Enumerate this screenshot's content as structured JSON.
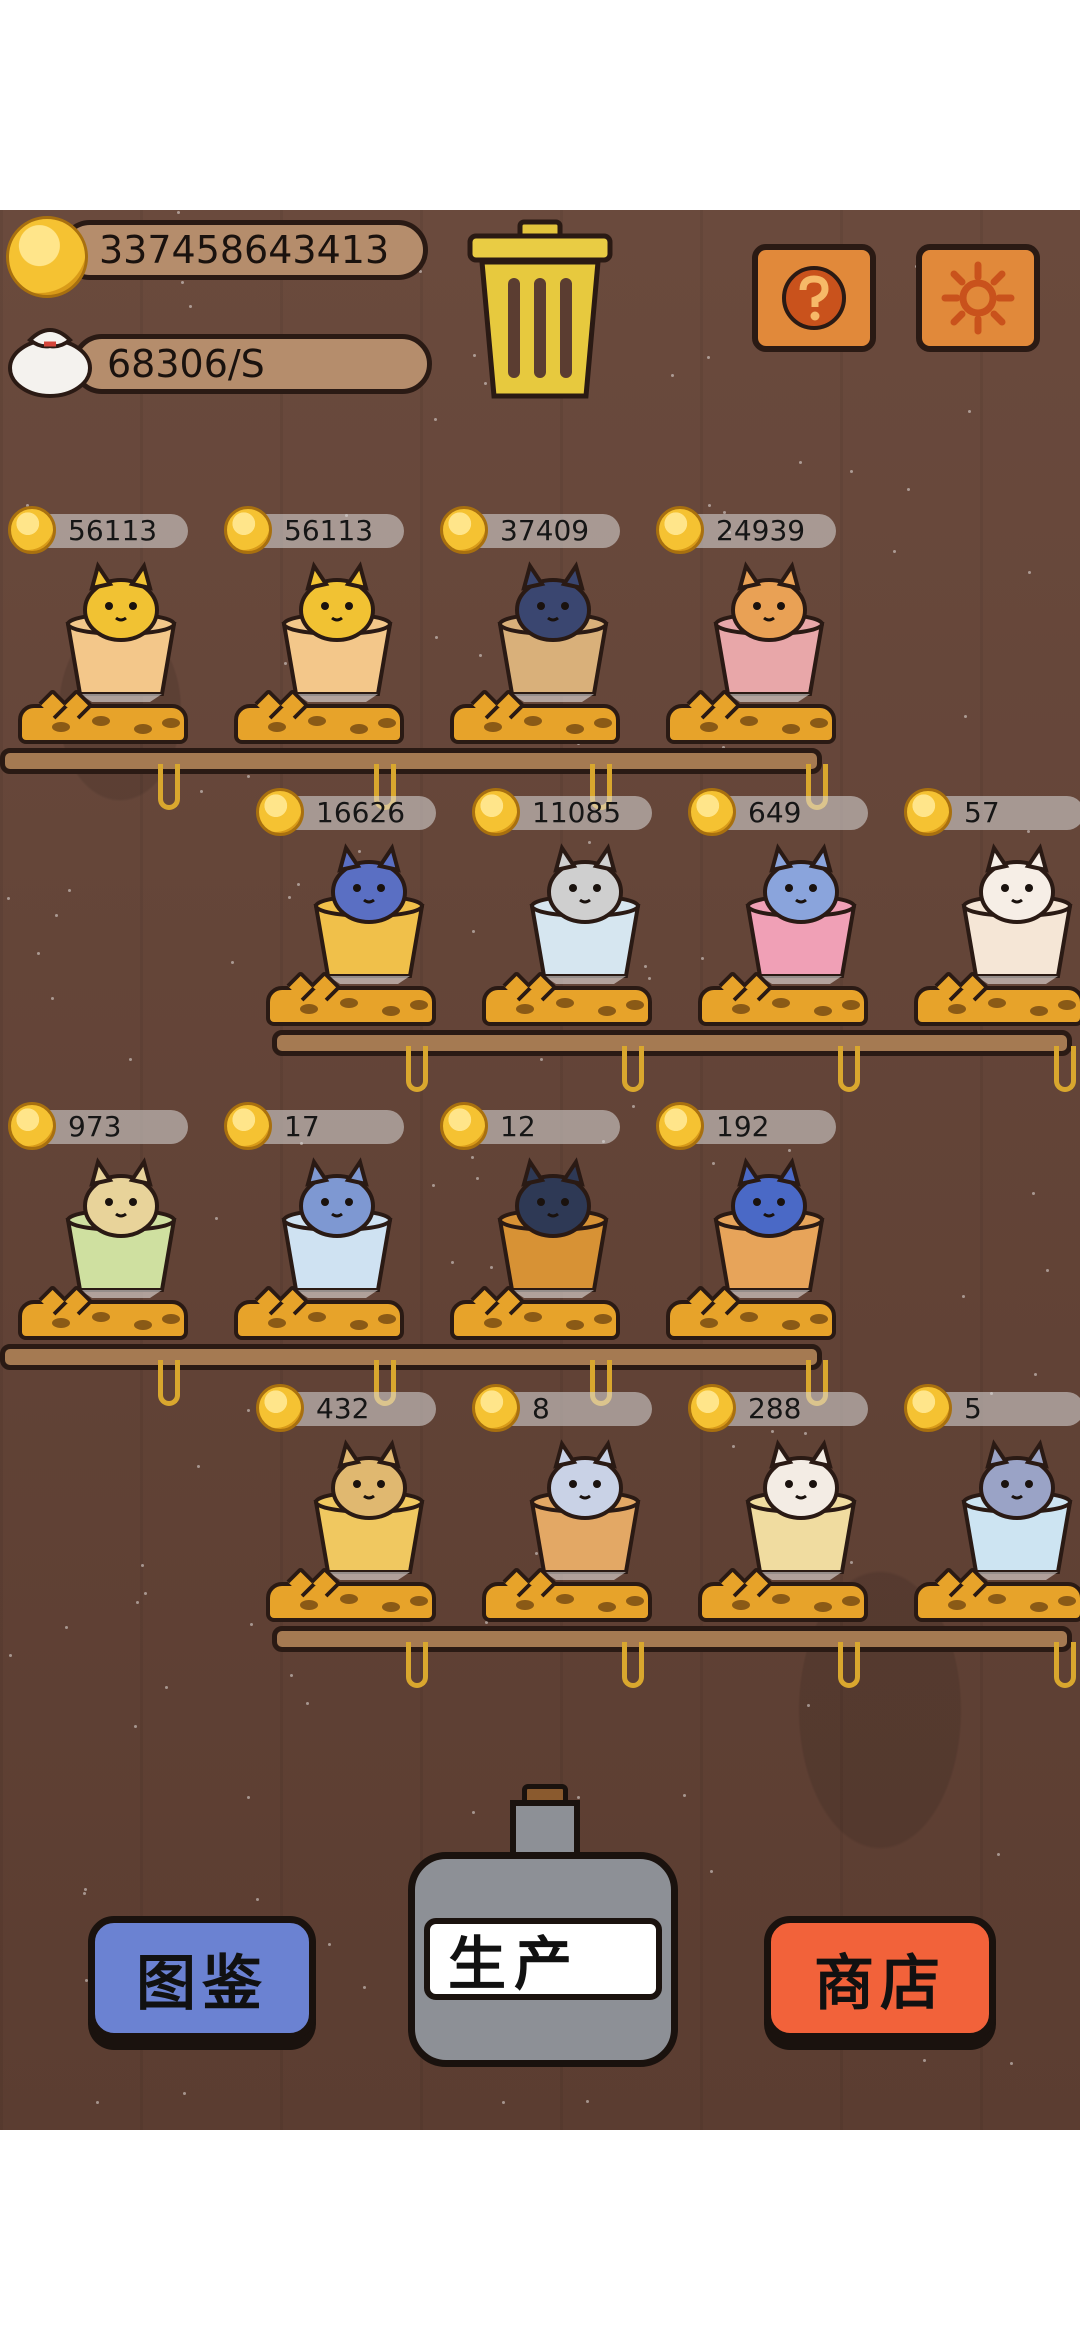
{
  "hud": {
    "coins": "337458643413",
    "rate": "68306/S",
    "trash_icon": "trash-can-icon",
    "help_icon": "question-mark-icon",
    "settings_icon": "gear-sun-icon"
  },
  "rows": [
    {
      "slots": [
        {
          "value": "56113",
          "cat": "yellow-cat-red-vest",
          "cup": "#f3c78a",
          "body": "#f1c233"
        },
        {
          "value": "56113",
          "cat": "yellow-cat-red-vest",
          "cup": "#f3c78a",
          "body": "#f1c233"
        },
        {
          "value": "37409",
          "cat": "navy-cat-in-cup",
          "cup": "#d9b07a",
          "body": "#3a4670"
        },
        {
          "value": "24939",
          "cat": "orange-cat-in-glass",
          "cup": "#e8a7a9",
          "body": "#e9a155"
        }
      ]
    },
    {
      "slots": [
        {
          "value": "16626",
          "cat": "purple-witch-cat-mug",
          "cup": "#f0c04a",
          "body": "#5a6fc3"
        },
        {
          "value": "11085",
          "cat": "siamese-cat-glass",
          "cup": "#d6e6f0",
          "body": "#cfcfcf"
        },
        {
          "value": "649",
          "cat": "blue-cat-parfait",
          "cup": "#f0a0b6",
          "body": "#8aa4dc"
        },
        {
          "value": "57",
          "cat": "white-cat-bowl",
          "cup": "#f5e6d6",
          "body": "#f6eee6"
        }
      ]
    },
    {
      "slots": [
        {
          "value": "973",
          "cat": "sunflower-cat-glass",
          "cup": "#cfe0a0",
          "body": "#e8d39a"
        },
        {
          "value": "17",
          "cat": "blue-cat-ice-glass",
          "cup": "#cfe2f2",
          "body": "#7e98d2"
        },
        {
          "value": "12",
          "cat": "pirate-cat-bowl",
          "cup": "#d79235",
          "body": "#2e3955"
        },
        {
          "value": "192",
          "cat": "blue-cat-red-hood-mug",
          "cup": "#e7a45a",
          "body": "#4a69c6"
        }
      ]
    },
    {
      "slots": [
        {
          "value": "432",
          "cat": "cat-in-tall-glass",
          "cup": "#f0c860",
          "body": "#e0b870"
        },
        {
          "value": "8",
          "cat": "sunglasses-cat-bowl",
          "cup": "#e3a865",
          "body": "#c9d2e6"
        },
        {
          "value": "288",
          "cat": "cat-red-jacket-cake",
          "cup": "#f0dca0",
          "body": "#f3ece4"
        },
        {
          "value": "5",
          "cat": "grey-cat-scarf-glass",
          "cup": "#cde4f2",
          "body": "#9aa3c6"
        }
      ]
    }
  ],
  "buttons": {
    "collection": "图鉴",
    "produce": "生产",
    "shop": "商店"
  },
  "colors": {
    "collection_bg": "#6b82d2",
    "shop_bg": "#f2623a"
  }
}
